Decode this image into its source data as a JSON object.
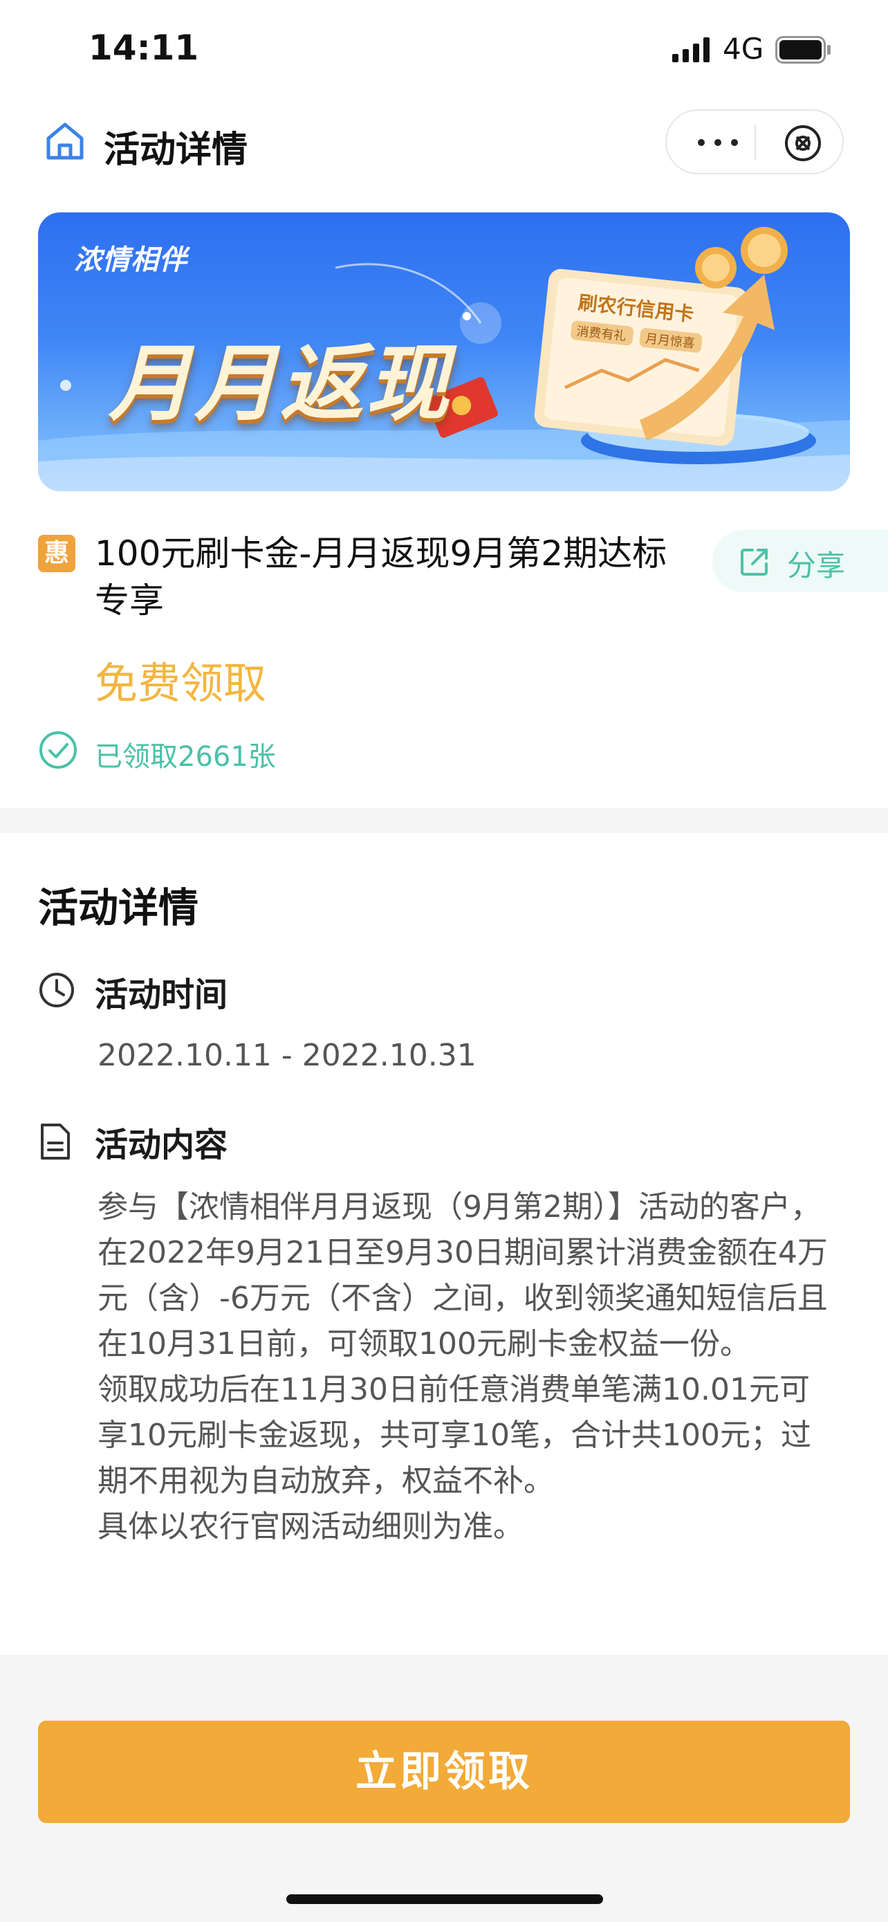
{
  "status_bar": {
    "time": "14:11",
    "network": "4G"
  },
  "nav": {
    "title": "活动详情"
  },
  "banner": {
    "brand": "浓情相伴",
    "title": "月月返现",
    "card_title": "刷农行信用卡",
    "tag_1": "消费有礼",
    "tag_2": "月月惊喜"
  },
  "product": {
    "badge": "惠",
    "title": "100元刷卡金-月月返现9月第2期达标专享",
    "share_label": "分享",
    "price_text": "免费领取",
    "claimed": "已领取2661张"
  },
  "details": {
    "section_title": "活动详情",
    "time_label": "活动时间",
    "time_value": "2022.10.11 - 2022.10.31",
    "content_label": "活动内容",
    "content_text": "参与【浓情相伴月月返现（9月第2期）】活动的客户，在2022年9月21日至9月30日期间累计消费金额在4万元（含）-6万元（不含）之间，收到领奖通知短信后且在10月31日前，可领取100元刷卡金权益一份。\n领取成功后在11月30日前任意消费单笔满10.01元可享10元刷卡金返现，共可享10笔，合计共100元；过期不用视为自动放弃，权益不补。\n具体以农行官网活动细则为准。"
  },
  "cta": {
    "label": "立即领取"
  },
  "colors": {
    "accent_orange": "#f2aa38",
    "free_text": "#f2b640",
    "teal": "#48c1a7",
    "brand_blue": "#2e6ff0"
  }
}
